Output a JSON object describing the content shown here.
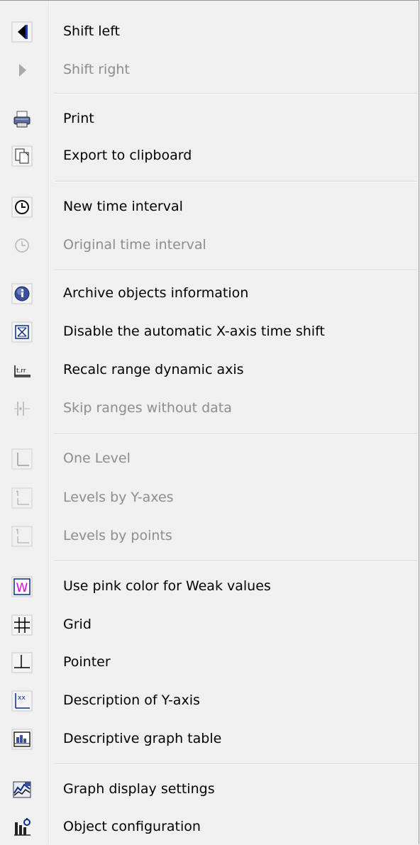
{
  "menu": {
    "items": [
      {
        "label": "Shift left",
        "icon": "arrow-left-icon",
        "enabled": true
      },
      {
        "label": "Shift right",
        "icon": "arrow-right-icon",
        "enabled": false
      },
      {
        "label": "Print",
        "icon": "printer-icon",
        "enabled": true
      },
      {
        "label": "Export to clipboard",
        "icon": "clipboard-icon",
        "enabled": true
      },
      {
        "label": "New time interval",
        "icon": "clock-icon",
        "enabled": true
      },
      {
        "label": "Original time interval",
        "icon": "clock-icon",
        "enabled": false
      },
      {
        "label": "Archive objects information",
        "icon": "info-icon",
        "enabled": true
      },
      {
        "label": "Disable the automatic X-axis time shift",
        "icon": "box-x-icon",
        "enabled": true
      },
      {
        "label": "Recalc range dynamic axis",
        "icon": "axis-range-icon",
        "enabled": true
      },
      {
        "label": "Skip ranges without data",
        "icon": "skip-ranges-icon",
        "enabled": false
      },
      {
        "label": "One Level",
        "icon": "one-level-icon",
        "enabled": false
      },
      {
        "label": "Levels by Y-axes",
        "icon": "levels-y-axes-icon",
        "enabled": false
      },
      {
        "label": "Levels by points",
        "icon": "levels-points-icon",
        "enabled": false
      },
      {
        "label": "Use pink color for Weak values",
        "icon": "weak-values-icon",
        "enabled": true
      },
      {
        "label": "Grid",
        "icon": "grid-icon",
        "enabled": true
      },
      {
        "label": "Pointer",
        "icon": "pointer-icon",
        "enabled": true
      },
      {
        "label": "Description of Y-axis",
        "icon": "y-axis-description-icon",
        "enabled": true
      },
      {
        "label": "Descriptive graph table",
        "icon": "graph-table-icon",
        "enabled": true
      },
      {
        "label": "Graph display settings",
        "icon": "graph-settings-icon",
        "enabled": true
      },
      {
        "label": "Object configuration",
        "icon": "object-config-icon",
        "enabled": true
      }
    ]
  },
  "colors": {
    "background": "#f0f0f0",
    "text": "#000000",
    "disabled_text": "#8d8d8d",
    "icon_blue": "#0a2a8c",
    "weak_pink": "#e000e0"
  }
}
